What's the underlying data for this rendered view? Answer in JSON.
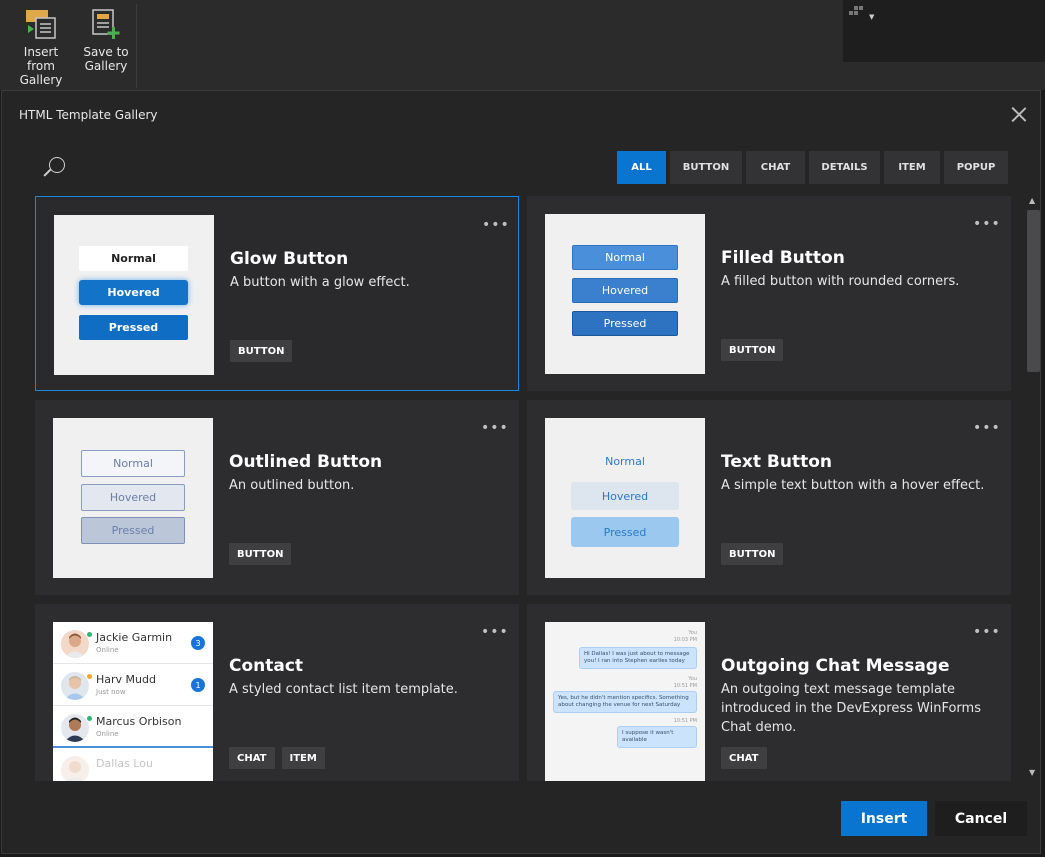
{
  "ribbon": {
    "insert_label_1": "Insert from",
    "insert_label_2": "Gallery",
    "save_label_1": "Save to",
    "save_label_2": "Gallery"
  },
  "dialog": {
    "title": "HTML Template Gallery",
    "insert_label": "Insert",
    "cancel_label": "Cancel"
  },
  "filters": [
    {
      "label": "ALL",
      "active": true
    },
    {
      "label": "BUTTON",
      "active": false
    },
    {
      "label": "CHAT",
      "active": false
    },
    {
      "label": "DETAILS",
      "active": false
    },
    {
      "label": "ITEM",
      "active": false
    },
    {
      "label": "POPUP",
      "active": false
    }
  ],
  "cards": [
    {
      "title": "Glow Button",
      "description": "A button with a glow effect.",
      "tags": [
        "BUTTON"
      ],
      "selected": true,
      "preview": [
        "Normal",
        "Hovered",
        "Pressed"
      ]
    },
    {
      "title": "Filled Button",
      "description": "A filled button with rounded corners.",
      "tags": [
        "BUTTON"
      ],
      "selected": false,
      "preview": [
        "Normal",
        "Hovered",
        "Pressed"
      ]
    },
    {
      "title": "Outlined Button",
      "description": "An outlined button.",
      "tags": [
        "BUTTON"
      ],
      "selected": false,
      "preview": [
        "Normal",
        "Hovered",
        "Pressed"
      ]
    },
    {
      "title": "Text Button",
      "description": "A simple text button with a hover effect.",
      "tags": [
        "BUTTON"
      ],
      "selected": false,
      "preview": [
        "Normal",
        "Hovered",
        "Pressed"
      ]
    },
    {
      "title": "Contact",
      "description": "A styled contact list item template.",
      "tags": [
        "CHAT",
        "ITEM"
      ],
      "selected": false,
      "preview": [
        {
          "name": "Jackie Garmin",
          "status": "Online",
          "badge": "3",
          "dot": "#2bb673"
        },
        {
          "name": "Harv Mudd",
          "status": "Just now",
          "badge": "1",
          "dot": "#f5a623"
        },
        {
          "name": "Marcus Orbison",
          "status": "Online",
          "badge": "",
          "dot": "#2bb673"
        },
        {
          "name": "Dallas Lou",
          "status": "",
          "badge": "",
          "dot": ""
        }
      ]
    },
    {
      "title": "Outgoing Chat Message",
      "description": "An outgoing text message template introduced in the DevExpress WinForms Chat demo.",
      "tags": [
        "CHAT"
      ],
      "selected": false,
      "preview": [
        {
          "who": "You",
          "time": "10:03 PM",
          "text": "Hi Dallas! I was just about to message you! I ran into Stephen earlies today"
        },
        {
          "who": "You",
          "time": "10:51 PM",
          "text": "Yes, but he didn't mention specifics. Something about changing the venue for next Saturday"
        },
        {
          "who": "",
          "time": "10:51 PM",
          "text": "I suppose it wasn't available"
        }
      ]
    }
  ]
}
